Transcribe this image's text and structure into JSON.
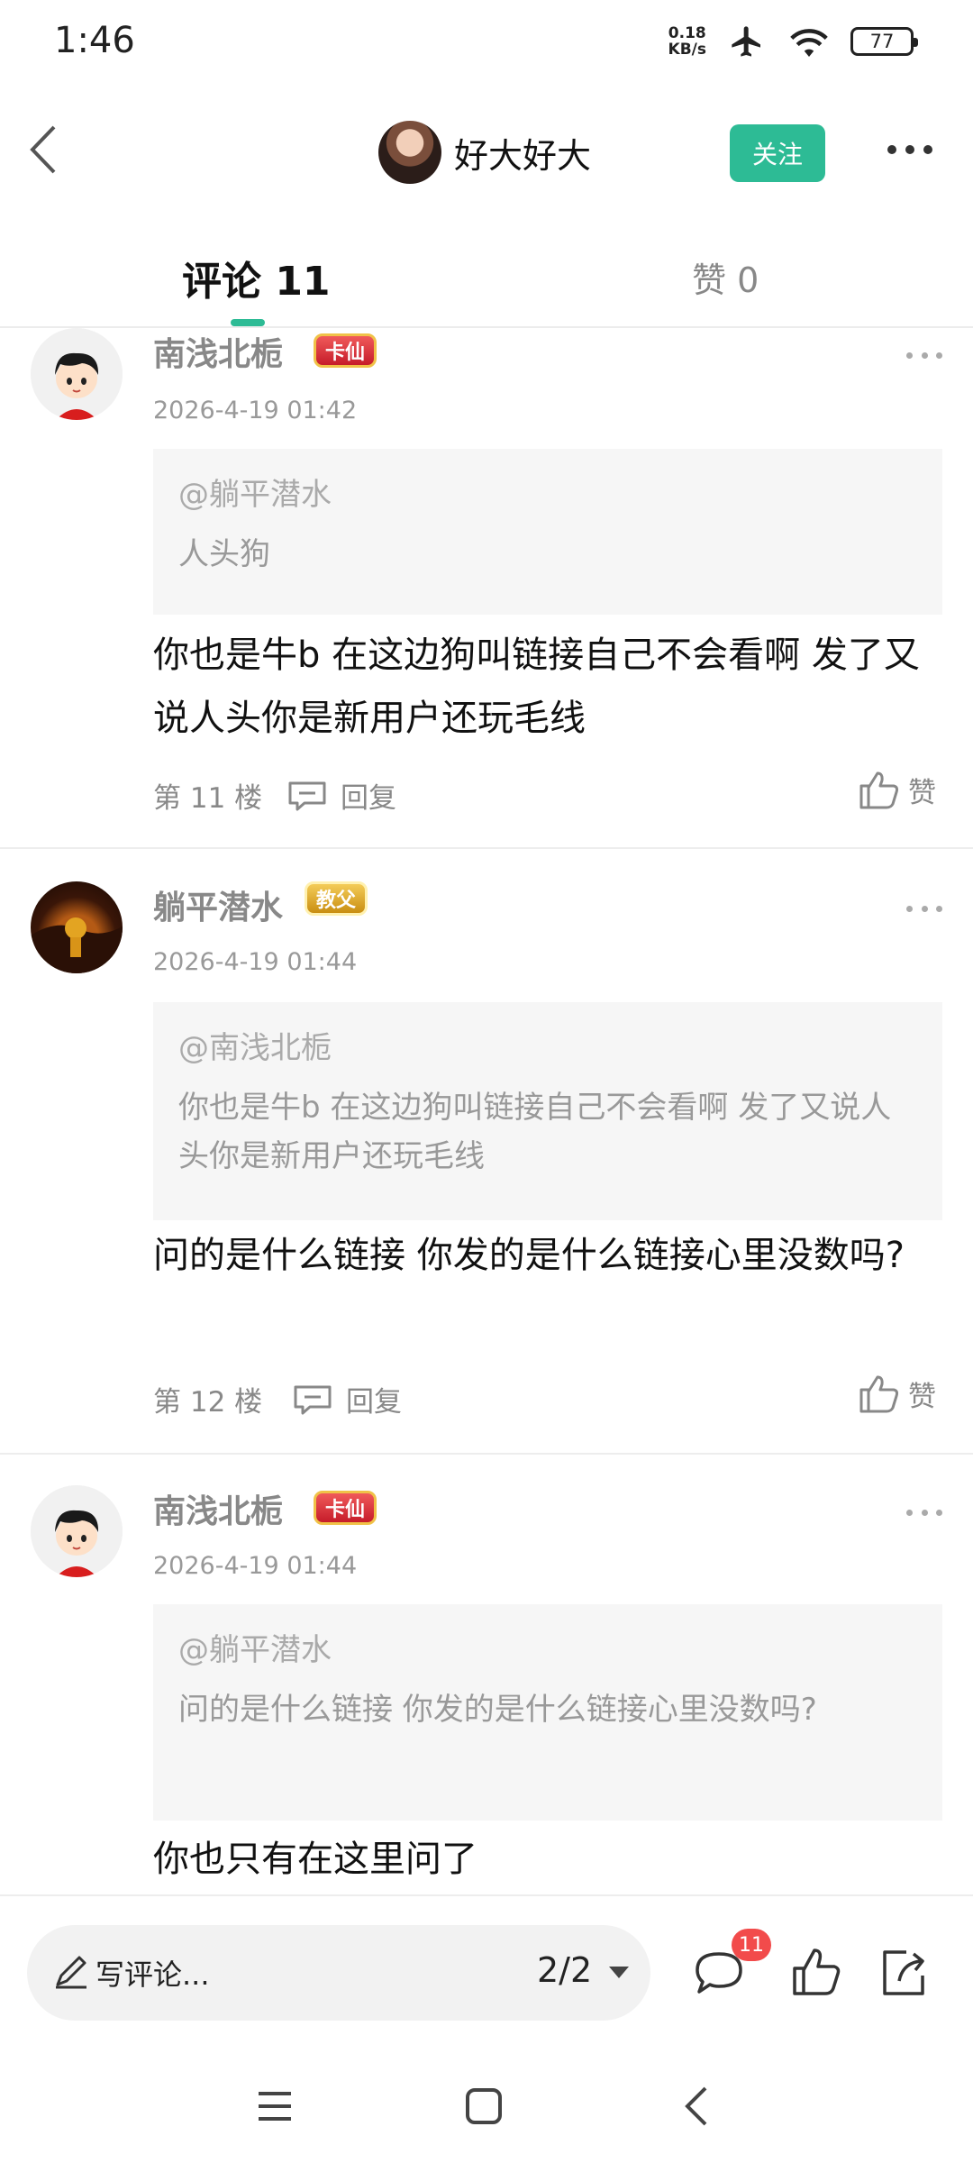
{
  "status_bar": {
    "time": "1:46",
    "net_speed_value": "0.18",
    "net_speed_unit": "KB/s",
    "battery": "77",
    "icons": [
      "airplane-icon",
      "wifi-icon",
      "battery-icon"
    ]
  },
  "header": {
    "username": "好大好大",
    "follow_label": "关注",
    "accent_color": "#2dbb95"
  },
  "tabs": {
    "comments": "评论 11",
    "likes": "赞 0"
  },
  "comments": [
    {
      "username": "南浅北栀",
      "badge": "卡仙",
      "timestamp": "2026-4-19 01:42",
      "quote_author": "@躺平潜水",
      "quote_text": "人头狗",
      "text": "你也是牛b   在这边狗叫链接自己不会看啊  发了又说人头你是新用户还玩毛线",
      "floor": "第 11 楼",
      "reply_label": "回复",
      "like_label": "赞"
    },
    {
      "username": "躺平潜水",
      "badge": "教父",
      "timestamp": "2026-4-19 01:44",
      "quote_author": "@南浅北栀",
      "quote_text": "你也是牛b   在这边狗叫链接自己不会看啊  发了又说人头你是新用户还玩毛线",
      "text": "问的是什么链接  你发的是什么链接心里没数吗?",
      "floor": "第 12 楼",
      "reply_label": "回复",
      "like_label": "赞"
    },
    {
      "username": "南浅北栀",
      "badge": "卡仙",
      "timestamp": "2026-4-19 01:44",
      "quote_author": "@躺平潜水",
      "quote_text": "问的是什么链接  你发的是什么链接心里没数吗?",
      "text": "你也只有在这里问了"
    }
  ],
  "bottom_bar": {
    "write_placeholder": "写评论...",
    "page_indicator": "2/2",
    "comment_count": "11"
  }
}
